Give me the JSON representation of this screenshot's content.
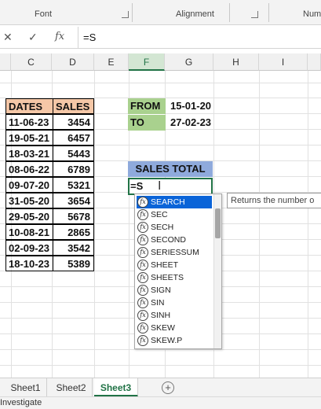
{
  "ribbon": {
    "groups": [
      "Font",
      "Alignment",
      "Num"
    ]
  },
  "formula_bar": {
    "cancel_icon": "✕",
    "enter_icon": "✓",
    "fx_icon": "fx",
    "value": "=S"
  },
  "grid": {
    "columns": [
      "C",
      "D",
      "E",
      "F",
      "G",
      "H",
      "I"
    ],
    "selected_column": "F",
    "dates_header": "DATES",
    "sales_header": "SALES",
    "rows": [
      {
        "date": "11-06-23",
        "sales": "3454"
      },
      {
        "date": "19-05-21",
        "sales": "6457"
      },
      {
        "date": "18-03-21",
        "sales": "5443"
      },
      {
        "date": "08-06-22",
        "sales": "6789"
      },
      {
        "date": "09-07-20",
        "sales": "5321"
      },
      {
        "date": "31-05-20",
        "sales": "3654"
      },
      {
        "date": "29-05-20",
        "sales": "5678"
      },
      {
        "date": "10-08-21",
        "sales": "2865"
      },
      {
        "date": "02-09-23",
        "sales": "3542"
      },
      {
        "date": "18-10-23",
        "sales": "5389"
      }
    ],
    "from_label": "FROM",
    "from_value": "15-01-20",
    "to_label": "TO",
    "to_value": "27-02-23",
    "sales_total_label": "SALES TOTAL",
    "active_cell_text": "=S"
  },
  "autocomplete": {
    "items": [
      "SEARCH",
      "SEC",
      "SECH",
      "SECOND",
      "SERIESSUM",
      "SHEET",
      "SHEETS",
      "SIGN",
      "SIN",
      "SINH",
      "SKEW",
      "SKEW.P"
    ],
    "selected_index": 0,
    "tooltip": "Returns the number o"
  },
  "sheets": {
    "tabs": [
      "Sheet1",
      "Sheet2",
      "Sheet3"
    ],
    "active": "Sheet3",
    "add_icon": "+"
  },
  "status_bar": {
    "text": "Investigate"
  },
  "colors": {
    "accent": "#217346",
    "orange_header": "#f5c7a7",
    "green_header": "#a9d18e",
    "blue_header": "#8faadc",
    "selection": "#0a64d8"
  }
}
